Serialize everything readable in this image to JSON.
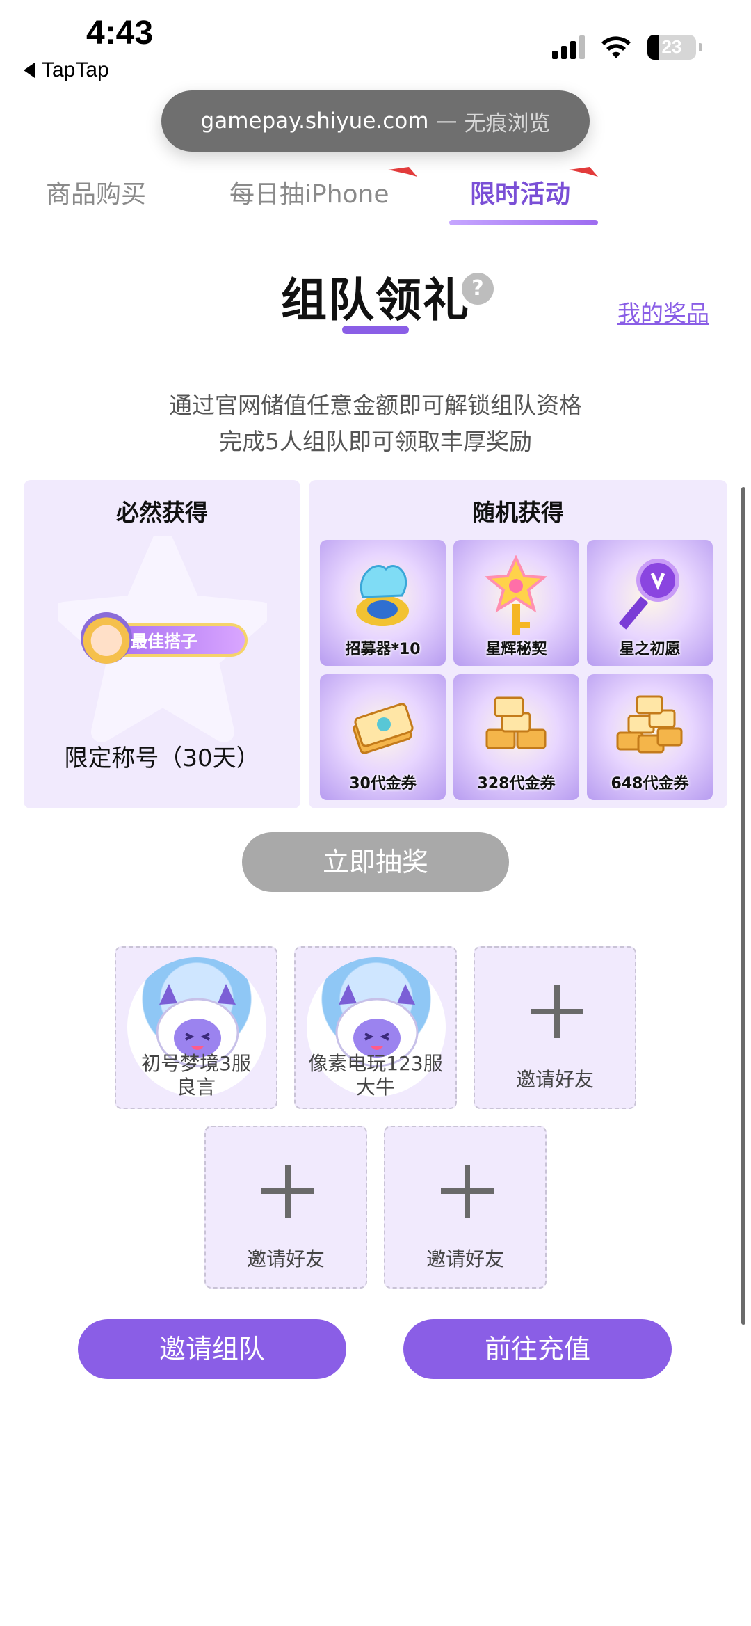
{
  "status_bar": {
    "time": "4:43",
    "back_app": "TapTap",
    "battery": "23"
  },
  "browser": {
    "url": "gamepay.shiyue.com",
    "separator": "—",
    "mode": "无痕浏览"
  },
  "tabs": [
    {
      "label": "商品购买",
      "active": false
    },
    {
      "label": "每日抽iPhone",
      "active": false
    },
    {
      "label": "限时活动",
      "active": true
    }
  ],
  "header": {
    "title": "组队领礼",
    "help": "?",
    "my_prizes": "我的奖品"
  },
  "description": {
    "line1": "通过官网储值任意金额即可解锁组队资格",
    "line2": "完成5人组队即可领取丰厚奖励"
  },
  "guaranteed": {
    "heading": "必然获得",
    "badge_text": "最佳搭子",
    "reward_name": "限定称号（30天）"
  },
  "random": {
    "heading": "随机获得",
    "prizes": [
      {
        "label": "招募器*10",
        "icon": "summoner-orb-icon"
      },
      {
        "label": "星辉秘契",
        "icon": "star-key-icon"
      },
      {
        "label": "星之初愿",
        "icon": "purple-key-icon"
      },
      {
        "label": "30代金券",
        "icon": "voucher-stack-icon"
      },
      {
        "label": "328代金券",
        "icon": "voucher-pile-icon"
      },
      {
        "label": "648代金券",
        "icon": "voucher-heap-icon"
      }
    ]
  },
  "draw_button": "立即抽奖",
  "team": {
    "members": [
      {
        "name_line1": "初号梦境3服",
        "name_line2": "良言"
      },
      {
        "name_line1": "像素电玩123服",
        "name_line2": "大牛"
      }
    ],
    "invite_label": "邀请好友"
  },
  "actions": {
    "invite_team": "邀请组队",
    "recharge": "前往充值"
  },
  "colors": {
    "accent": "#8a5ee6",
    "panel_bg": "#f1eafd",
    "disabled_button": "#a9a9a9"
  }
}
